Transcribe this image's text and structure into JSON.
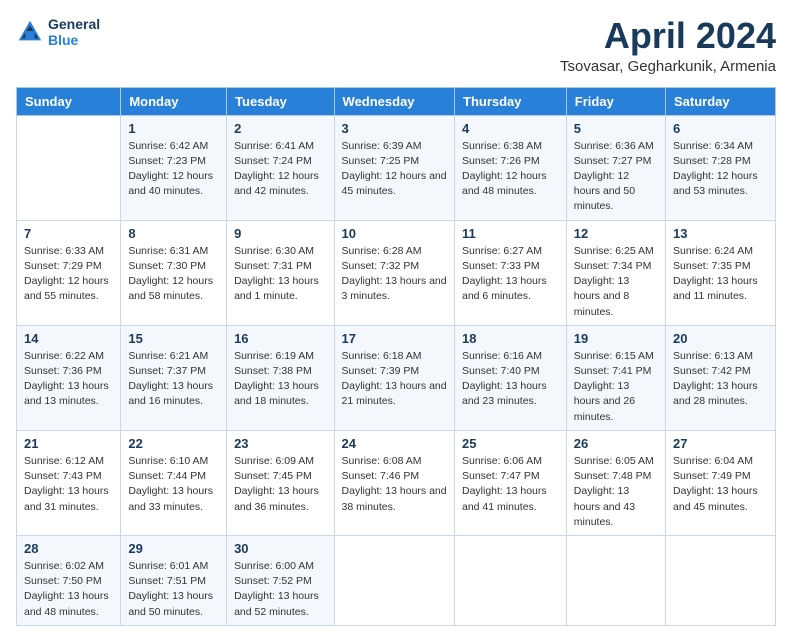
{
  "header": {
    "logo_line1": "General",
    "logo_line2": "Blue",
    "main_title": "April 2024",
    "subtitle": "Tsovasar, Gegharkunik, Armenia"
  },
  "days_of_week": [
    "Sunday",
    "Monday",
    "Tuesday",
    "Wednesday",
    "Thursday",
    "Friday",
    "Saturday"
  ],
  "weeks": [
    [
      {
        "num": "",
        "sunrise": "",
        "sunset": "",
        "daylight": ""
      },
      {
        "num": "1",
        "sunrise": "Sunrise: 6:42 AM",
        "sunset": "Sunset: 7:23 PM",
        "daylight": "Daylight: 12 hours and 40 minutes."
      },
      {
        "num": "2",
        "sunrise": "Sunrise: 6:41 AM",
        "sunset": "Sunset: 7:24 PM",
        "daylight": "Daylight: 12 hours and 42 minutes."
      },
      {
        "num": "3",
        "sunrise": "Sunrise: 6:39 AM",
        "sunset": "Sunset: 7:25 PM",
        "daylight": "Daylight: 12 hours and 45 minutes."
      },
      {
        "num": "4",
        "sunrise": "Sunrise: 6:38 AM",
        "sunset": "Sunset: 7:26 PM",
        "daylight": "Daylight: 12 hours and 48 minutes."
      },
      {
        "num": "5",
        "sunrise": "Sunrise: 6:36 AM",
        "sunset": "Sunset: 7:27 PM",
        "daylight": "Daylight: 12 hours and 50 minutes."
      },
      {
        "num": "6",
        "sunrise": "Sunrise: 6:34 AM",
        "sunset": "Sunset: 7:28 PM",
        "daylight": "Daylight: 12 hours and 53 minutes."
      }
    ],
    [
      {
        "num": "7",
        "sunrise": "Sunrise: 6:33 AM",
        "sunset": "Sunset: 7:29 PM",
        "daylight": "Daylight: 12 hours and 55 minutes."
      },
      {
        "num": "8",
        "sunrise": "Sunrise: 6:31 AM",
        "sunset": "Sunset: 7:30 PM",
        "daylight": "Daylight: 12 hours and 58 minutes."
      },
      {
        "num": "9",
        "sunrise": "Sunrise: 6:30 AM",
        "sunset": "Sunset: 7:31 PM",
        "daylight": "Daylight: 13 hours and 1 minute."
      },
      {
        "num": "10",
        "sunrise": "Sunrise: 6:28 AM",
        "sunset": "Sunset: 7:32 PM",
        "daylight": "Daylight: 13 hours and 3 minutes."
      },
      {
        "num": "11",
        "sunrise": "Sunrise: 6:27 AM",
        "sunset": "Sunset: 7:33 PM",
        "daylight": "Daylight: 13 hours and 6 minutes."
      },
      {
        "num": "12",
        "sunrise": "Sunrise: 6:25 AM",
        "sunset": "Sunset: 7:34 PM",
        "daylight": "Daylight: 13 hours and 8 minutes."
      },
      {
        "num": "13",
        "sunrise": "Sunrise: 6:24 AM",
        "sunset": "Sunset: 7:35 PM",
        "daylight": "Daylight: 13 hours and 11 minutes."
      }
    ],
    [
      {
        "num": "14",
        "sunrise": "Sunrise: 6:22 AM",
        "sunset": "Sunset: 7:36 PM",
        "daylight": "Daylight: 13 hours and 13 minutes."
      },
      {
        "num": "15",
        "sunrise": "Sunrise: 6:21 AM",
        "sunset": "Sunset: 7:37 PM",
        "daylight": "Daylight: 13 hours and 16 minutes."
      },
      {
        "num": "16",
        "sunrise": "Sunrise: 6:19 AM",
        "sunset": "Sunset: 7:38 PM",
        "daylight": "Daylight: 13 hours and 18 minutes."
      },
      {
        "num": "17",
        "sunrise": "Sunrise: 6:18 AM",
        "sunset": "Sunset: 7:39 PM",
        "daylight": "Daylight: 13 hours and 21 minutes."
      },
      {
        "num": "18",
        "sunrise": "Sunrise: 6:16 AM",
        "sunset": "Sunset: 7:40 PM",
        "daylight": "Daylight: 13 hours and 23 minutes."
      },
      {
        "num": "19",
        "sunrise": "Sunrise: 6:15 AM",
        "sunset": "Sunset: 7:41 PM",
        "daylight": "Daylight: 13 hours and 26 minutes."
      },
      {
        "num": "20",
        "sunrise": "Sunrise: 6:13 AM",
        "sunset": "Sunset: 7:42 PM",
        "daylight": "Daylight: 13 hours and 28 minutes."
      }
    ],
    [
      {
        "num": "21",
        "sunrise": "Sunrise: 6:12 AM",
        "sunset": "Sunset: 7:43 PM",
        "daylight": "Daylight: 13 hours and 31 minutes."
      },
      {
        "num": "22",
        "sunrise": "Sunrise: 6:10 AM",
        "sunset": "Sunset: 7:44 PM",
        "daylight": "Daylight: 13 hours and 33 minutes."
      },
      {
        "num": "23",
        "sunrise": "Sunrise: 6:09 AM",
        "sunset": "Sunset: 7:45 PM",
        "daylight": "Daylight: 13 hours and 36 minutes."
      },
      {
        "num": "24",
        "sunrise": "Sunrise: 6:08 AM",
        "sunset": "Sunset: 7:46 PM",
        "daylight": "Daylight: 13 hours and 38 minutes."
      },
      {
        "num": "25",
        "sunrise": "Sunrise: 6:06 AM",
        "sunset": "Sunset: 7:47 PM",
        "daylight": "Daylight: 13 hours and 41 minutes."
      },
      {
        "num": "26",
        "sunrise": "Sunrise: 6:05 AM",
        "sunset": "Sunset: 7:48 PM",
        "daylight": "Daylight: 13 hours and 43 minutes."
      },
      {
        "num": "27",
        "sunrise": "Sunrise: 6:04 AM",
        "sunset": "Sunset: 7:49 PM",
        "daylight": "Daylight: 13 hours and 45 minutes."
      }
    ],
    [
      {
        "num": "28",
        "sunrise": "Sunrise: 6:02 AM",
        "sunset": "Sunset: 7:50 PM",
        "daylight": "Daylight: 13 hours and 48 minutes."
      },
      {
        "num": "29",
        "sunrise": "Sunrise: 6:01 AM",
        "sunset": "Sunset: 7:51 PM",
        "daylight": "Daylight: 13 hours and 50 minutes."
      },
      {
        "num": "30",
        "sunrise": "Sunrise: 6:00 AM",
        "sunset": "Sunset: 7:52 PM",
        "daylight": "Daylight: 13 hours and 52 minutes."
      },
      {
        "num": "",
        "sunrise": "",
        "sunset": "",
        "daylight": ""
      },
      {
        "num": "",
        "sunrise": "",
        "sunset": "",
        "daylight": ""
      },
      {
        "num": "",
        "sunrise": "",
        "sunset": "",
        "daylight": ""
      },
      {
        "num": "",
        "sunrise": "",
        "sunset": "",
        "daylight": ""
      }
    ]
  ]
}
